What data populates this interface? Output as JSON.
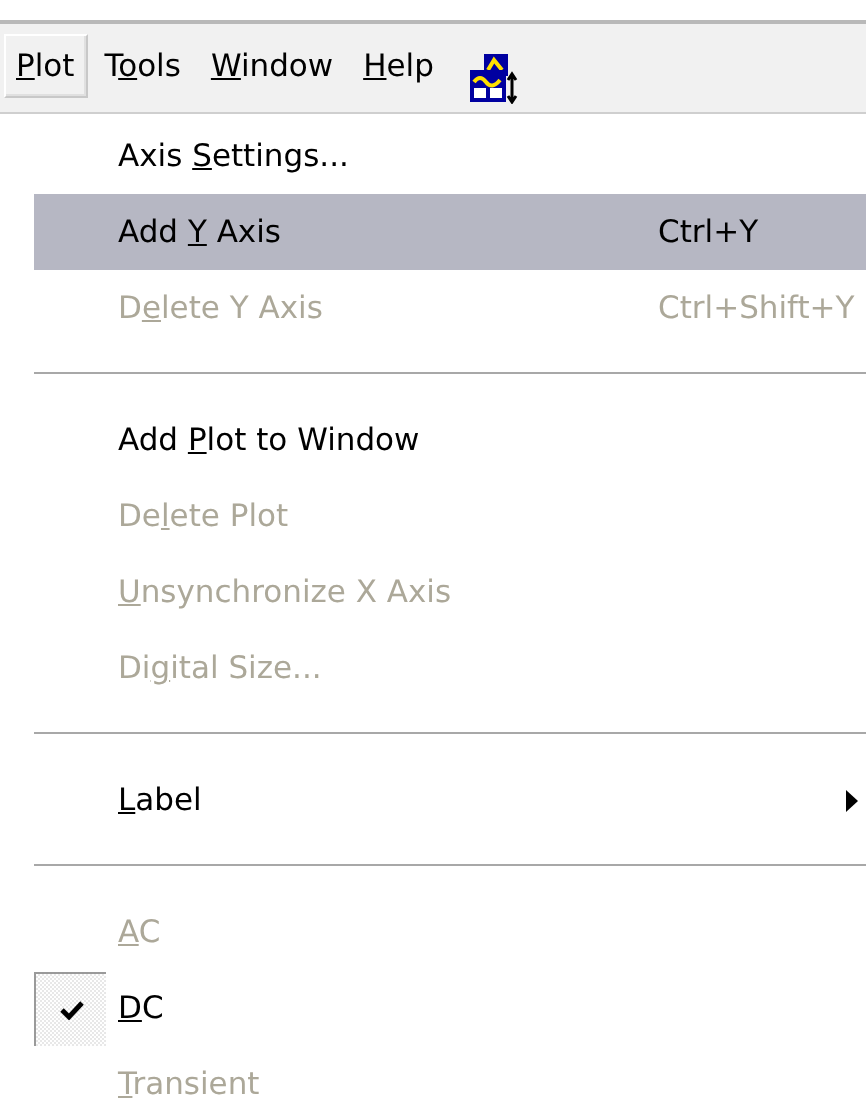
{
  "menubar": [
    {
      "key": "P",
      "post": "lot",
      "selected": true
    },
    {
      "pre": "T",
      "key": "o",
      "post": "ols",
      "selected": false
    },
    {
      "key": "W",
      "post": "indow",
      "selected": false
    },
    {
      "key": "H",
      "post": "elp",
      "selected": false
    }
  ],
  "menu": [
    {
      "kind": "item",
      "label": {
        "pre": "Axis ",
        "key": "S",
        "post": "ettings..."
      },
      "disabled": false,
      "selected": false,
      "checked": false
    },
    {
      "kind": "item",
      "label": {
        "pre": "Add ",
        "key": "Y",
        "post": " Axis"
      },
      "shortcut": "Ctrl+Y",
      "disabled": false,
      "selected": true,
      "checked": false
    },
    {
      "kind": "item",
      "label": {
        "pre": "D",
        "key": "e",
        "post": "lete Y Axis"
      },
      "shortcut": "Ctrl+Shift+Y",
      "disabled": true,
      "selected": false,
      "checked": false
    },
    {
      "kind": "separator"
    },
    {
      "kind": "item",
      "label": {
        "pre": "Add ",
        "key": "P",
        "post": "lot to Window"
      },
      "disabled": false,
      "selected": false,
      "checked": false
    },
    {
      "kind": "item",
      "label": {
        "pre": "De",
        "key": "l",
        "post": "ete Plot"
      },
      "disabled": true,
      "selected": false,
      "checked": false
    },
    {
      "kind": "item",
      "label": {
        "key": "U",
        "post": "nsynchronize X Axis"
      },
      "disabled": true,
      "selected": false,
      "checked": false
    },
    {
      "kind": "item",
      "label": {
        "pre": "Di",
        "key": "g",
        "post": "ital Size..."
      },
      "disabled": true,
      "selected": false,
      "checked": false
    },
    {
      "kind": "separator"
    },
    {
      "kind": "submenu",
      "label": {
        "key": "L",
        "post": "abel"
      },
      "disabled": false,
      "selected": false,
      "checked": false
    },
    {
      "kind": "separator"
    },
    {
      "kind": "item",
      "label": {
        "key": "A",
        "post": "C"
      },
      "disabled": true,
      "selected": false,
      "checked": false
    },
    {
      "kind": "item",
      "label": {
        "key": "D",
        "post": "C"
      },
      "disabled": false,
      "selected": false,
      "checked": true
    },
    {
      "kind": "item",
      "label": {
        "key": "T",
        "post": "ransient"
      },
      "disabled": true,
      "selected": false,
      "checked": false
    }
  ]
}
